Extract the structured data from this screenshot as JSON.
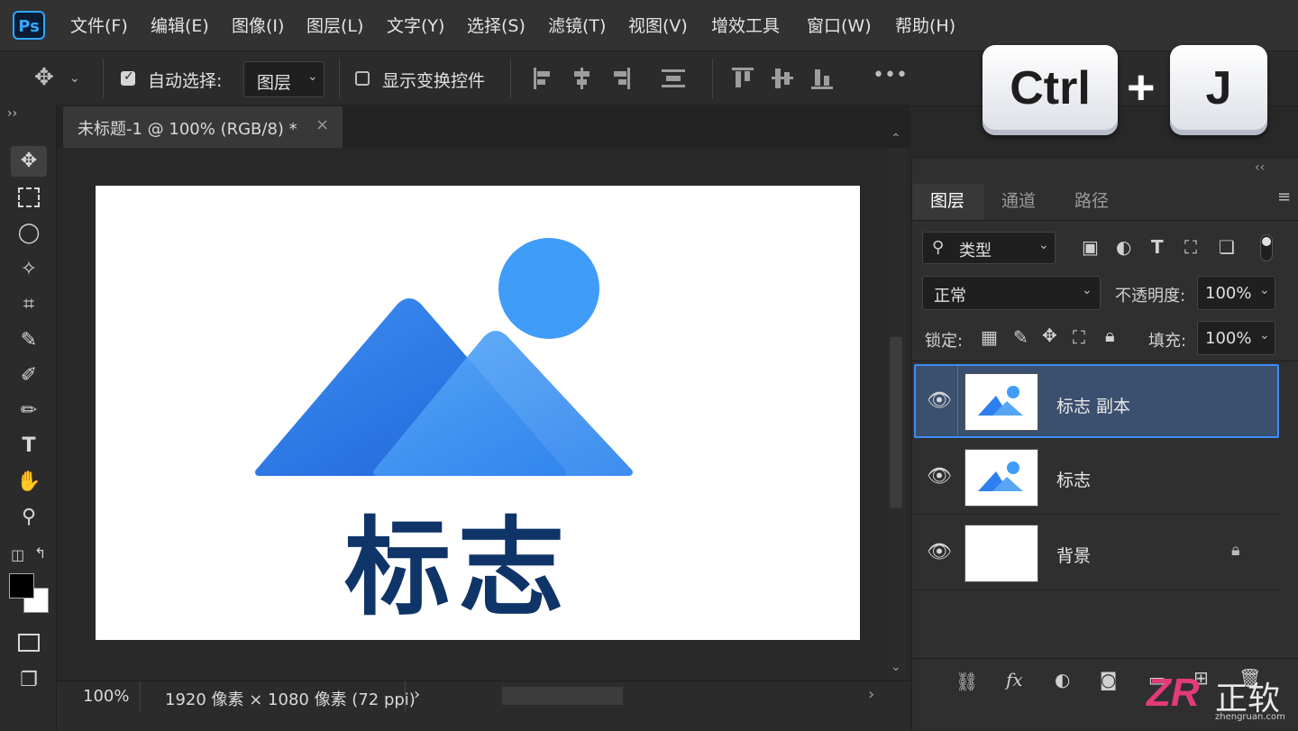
{
  "menu": {
    "app_logo": "Ps",
    "items": [
      "文件(F)",
      "编辑(E)",
      "图像(I)",
      "图层(L)",
      "文字(Y)",
      "选择(S)",
      "滤镜(T)",
      "视图(V)",
      "增效工具",
      "窗口(W)",
      "帮助(H)"
    ]
  },
  "options": {
    "auto_select_label": "自动选择:",
    "auto_select_checked": true,
    "auto_select_target": "图层",
    "show_transform_label": "显示变换控件",
    "show_transform_checked": false
  },
  "shortcut": {
    "key1": "Ctrl",
    "plus": "+",
    "key2": "J"
  },
  "document": {
    "tab_title": "未标题-1 @ 100% (RGB/8) *",
    "close_glyph": "×",
    "logo_text": "标志",
    "zoom": "100%",
    "doc_info": "1920 像素 × 1080 像素 (72 ppi)"
  },
  "panel": {
    "tabs": [
      "图层",
      "通道",
      "路径"
    ],
    "active_tab": "图层",
    "filter_kind": "类型",
    "blend_mode": "正常",
    "opacity_label": "不透明度:",
    "opacity_value": "100%",
    "lock_label": "锁定:",
    "fill_label": "填充:",
    "fill_value": "100%",
    "layers": [
      {
        "name": "标志 副本",
        "selected": true,
        "visible": true,
        "locked": false
      },
      {
        "name": "标志",
        "selected": false,
        "visible": true,
        "locked": false
      },
      {
        "name": "背景",
        "selected": false,
        "visible": true,
        "locked": true
      }
    ]
  },
  "watermark": {
    "brand": "正软",
    "url": "zhengruan.com"
  },
  "colors": {
    "accent": "#3d8ef5",
    "logo_dark_blue": "#0f3468",
    "mountain_blue": "#2d7ff0",
    "sun_blue": "#3f9cf8"
  }
}
